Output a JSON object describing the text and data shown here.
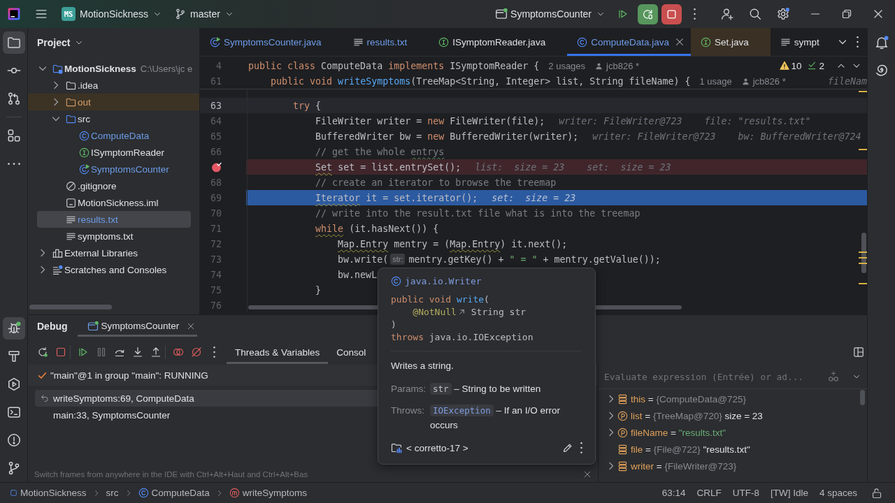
{
  "title_bar": {
    "project_badge": "MS",
    "project": "MotionSickness",
    "branch": "master",
    "run_configuration": "SymptomsCounter"
  },
  "left_toolbar": {
    "top": [
      {
        "kind": "project",
        "selected": true
      },
      {
        "kind": "commit",
        "selected": false
      },
      {
        "kind": "pull_requests",
        "selected": false
      },
      {
        "kind": "structure",
        "selected": false
      },
      {
        "kind": "more",
        "selected": false
      }
    ],
    "bottom": [
      {
        "kind": "debug",
        "selected": true
      },
      {
        "kind": "build",
        "selected": false
      },
      {
        "kind": "services",
        "selected": false
      },
      {
        "kind": "terminal",
        "selected": false
      },
      {
        "kind": "problems",
        "selected": false
      },
      {
        "kind": "git",
        "selected": false
      }
    ]
  },
  "project_panel": {
    "title": "Project",
    "tree": [
      {
        "kind": "module",
        "label": "MotionSickness",
        "path": "C:\\Users\\jc e",
        "expanded": true,
        "selected": false,
        "modified": false,
        "children": [
          {
            "kind": "folder",
            "label": ".idea",
            "expanded": false,
            "selected": false,
            "modified": false
          },
          {
            "kind": "excluded_folder",
            "label": "out",
            "expanded": false,
            "selected": false,
            "modified": false
          },
          {
            "kind": "source_folder",
            "label": "src",
            "expanded": true,
            "selected": false,
            "modified": false,
            "children": [
              {
                "kind": "class",
                "label": "ComputeData",
                "selected": false,
                "modified": true
              },
              {
                "kind": "interface",
                "label": "ISymptomReader",
                "selected": false,
                "modified": false
              },
              {
                "kind": "runnable_class",
                "label": "SymptomsCounter",
                "selected": false,
                "modified": true
              }
            ]
          },
          {
            "kind": "ignore_file",
            "label": ".gitignore",
            "selected": false,
            "modified": false
          },
          {
            "kind": "module_file",
            "label": "MotionSickness.iml",
            "selected": false,
            "modified": false
          },
          {
            "kind": "text_file",
            "label": "results.txt",
            "selected": true,
            "modified": true
          },
          {
            "kind": "text_file",
            "label": "symptoms.txt",
            "selected": false,
            "modified": false
          }
        ]
      },
      {
        "kind": "library",
        "label": "External Libraries",
        "expanded": false,
        "selected": false,
        "modified": false
      },
      {
        "kind": "scratches",
        "label": "Scratches and Consoles",
        "expanded": false,
        "selected": false,
        "modified": false
      }
    ]
  },
  "editor": {
    "tabs": [
      {
        "kind": "runnable_class",
        "label": "SymptomsCounter.java",
        "selected": false,
        "modified": true,
        "non_project": false
      },
      {
        "kind": "text_file",
        "label": "results.txt",
        "selected": false,
        "modified": true,
        "non_project": false
      },
      {
        "kind": "interface",
        "label": "ISymptomReader.java",
        "selected": false,
        "modified": false,
        "non_project": false
      },
      {
        "kind": "class",
        "label": "ComputeData.java",
        "selected": true,
        "modified": true,
        "non_project": false
      },
      {
        "kind": "interface",
        "label": "Set.java",
        "selected": false,
        "modified": false,
        "non_project": true
      },
      {
        "kind": "text_file",
        "label": "sympt",
        "selected": false,
        "modified": false,
        "non_project": false
      }
    ],
    "problems": {
      "warnings": "10",
      "typos": "2"
    },
    "sticky_lines": [
      {
        "number": "4",
        "tokens": [
          {
            "text": "public class ",
            "kind": "keyword"
          },
          {
            "text": "ComputeData ",
            "kind": "plain"
          },
          {
            "text": "implements ",
            "kind": "keyword"
          },
          {
            "text": "ISymptomReader {",
            "kind": "plain"
          }
        ],
        "usages": "2 usages",
        "author": "jcb826 *"
      },
      {
        "number": "61",
        "tokens": [
          {
            "text": "    public void ",
            "kind": "keyword"
          },
          {
            "text": "writeSymptoms",
            "kind": "method"
          },
          {
            "text": "(TreeMap<String, Integer> list, String fileName) {",
            "kind": "plain"
          }
        ],
        "usages": "1 usage",
        "author": "jcb826 *",
        "hint": "fileNam"
      }
    ],
    "lines": [
      {
        "number": "63",
        "caret": true,
        "breakpoint": false,
        "execution_point": false,
        "tokens": [
          {
            "text": "        try",
            "kind": "keyword"
          },
          {
            "text": " {",
            "kind": "plain"
          }
        ]
      },
      {
        "number": "64",
        "caret": false,
        "breakpoint": false,
        "execution_point": false,
        "tokens": [
          {
            "text": "            FileWriter writer = ",
            "kind": "plain"
          },
          {
            "text": "new",
            "kind": "keyword"
          },
          {
            "text": " FileWriter(file);",
            "kind": "plain"
          },
          {
            "text": "writer: FileWriter@723    file: \"results.txt\"",
            "kind": "hint"
          }
        ]
      },
      {
        "number": "65",
        "caret": false,
        "breakpoint": false,
        "execution_point": false,
        "tokens": [
          {
            "text": "            BufferedWriter bw = ",
            "kind": "plain"
          },
          {
            "text": "new",
            "kind": "keyword"
          },
          {
            "text": " BufferedWriter(writer);",
            "kind": "plain"
          },
          {
            "text": "writer: FileWriter@723    bw: BufferedWriter@724",
            "kind": "hint"
          }
        ]
      },
      {
        "number": "66",
        "caret": false,
        "breakpoint": false,
        "execution_point": false,
        "tokens": [
          {
            "text": "            // get the whole ",
            "kind": "comment"
          },
          {
            "text": "entrys",
            "kind": "comment_warned"
          }
        ]
      },
      {
        "caret": false,
        "breakpoint": true,
        "execution_point": false,
        "tokens": [
          {
            "text": "            Set",
            "kind": "plain_warned"
          },
          {
            "text": " set = list.entrySet();",
            "kind": "plain"
          },
          {
            "text": "list:  size = 23    set:  size = 23",
            "kind": "hint"
          }
        ]
      },
      {
        "number": "68",
        "caret": false,
        "breakpoint": false,
        "execution_point": false,
        "tokens": [
          {
            "text": "            // create an iterator to browse the treemap",
            "kind": "comment"
          }
        ]
      },
      {
        "number": "69",
        "caret": false,
        "breakpoint": false,
        "execution_point": true,
        "tokens": [
          {
            "text": "            Iterator",
            "kind": "plain_warned"
          },
          {
            "text": " it = set.iterator();",
            "kind": "plain"
          },
          {
            "text": "set:  size = 23",
            "kind": "hint"
          }
        ]
      },
      {
        "number": "70",
        "caret": false,
        "breakpoint": false,
        "execution_point": false,
        "tokens": [
          {
            "text": "            // write into the result.txt file what is into the treemap",
            "kind": "comment"
          }
        ]
      },
      {
        "number": "71",
        "caret": false,
        "breakpoint": false,
        "execution_point": false,
        "tokens": [
          {
            "text": "            while",
            "kind": "keyword_warned"
          },
          {
            "text": " (it.hasNext()) {",
            "kind": "plain"
          }
        ]
      },
      {
        "number": "72",
        "caret": false,
        "breakpoint": false,
        "execution_point": false,
        "tokens": [
          {
            "text": "                Map.Entry",
            "kind": "plain_warned"
          },
          {
            "text": " mentry = (",
            "kind": "plain"
          },
          {
            "text": "Map.Entry",
            "kind": "plain_warned"
          },
          {
            "text": ") it.next();",
            "kind": "plain"
          }
        ]
      },
      {
        "number": "73",
        "caret": false,
        "breakpoint": false,
        "execution_point": false,
        "tokens": [
          {
            "text": "                bw.write(",
            "kind": "plain"
          },
          {
            "text": "str:",
            "kind": "inlay"
          },
          {
            "text": "mentry.getKey() + ",
            "kind": "plain"
          },
          {
            "text": "\" = \"",
            "kind": "string"
          },
          {
            "text": " + mentry.getValue());",
            "kind": "plain"
          }
        ]
      },
      {
        "number": "74",
        "caret": false,
        "breakpoint": false,
        "execution_point": false,
        "tokens": [
          {
            "text": "                bw.newL",
            "kind": "plain"
          }
        ]
      },
      {
        "number": "75",
        "caret": false,
        "breakpoint": false,
        "execution_point": false,
        "tokens": [
          {
            "text": "            }",
            "kind": "plain"
          }
        ]
      },
      {
        "number": "76",
        "caret": false,
        "breakpoint": false,
        "execution_point": false
      }
    ]
  },
  "debug": {
    "title": "Debug",
    "session": "SymptomsCounter",
    "toolbar": [
      {
        "kind": "rerun",
        "disabled": false
      },
      {
        "kind": "stop",
        "disabled": false
      },
      {
        "kind": "resume",
        "disabled": false
      },
      {
        "kind": "pause",
        "disabled": true
      },
      {
        "kind": "step_over",
        "disabled": false
      },
      {
        "kind": "step_into",
        "disabled": false
      },
      {
        "kind": "step_out",
        "disabled": false
      },
      {
        "kind": "view_breakpoints",
        "disabled": false
      },
      {
        "kind": "mute_breakpoints",
        "disabled": false
      },
      {
        "kind": "more",
        "disabled": false
      }
    ],
    "tabs": [
      {
        "label": "Threads & Variables",
        "selected": true
      },
      {
        "label": "Consol",
        "selected": false
      }
    ],
    "thread": "\"main\"@1 in group \"main\": RUNNING",
    "frames": [
      {
        "label": "writeSymptoms:69, ComputeData",
        "selected": true
      },
      {
        "label": "main:33, SymptomsCounter",
        "selected": false
      }
    ],
    "hint": "Switch frames from anywhere in the IDE with Ctrl+Alt+Haut and Ctrl+Alt+Bas",
    "evaluate": {
      "placeholder": "Evaluate expression (Entrée) or ad..."
    },
    "variables": [
      {
        "kind": "field",
        "name": "this",
        "equals": "=",
        "ref": "{ComputeData@725}",
        "expanded": false
      },
      {
        "kind": "param",
        "name": "list",
        "equals": "=",
        "ref": "{TreeMap@720}",
        "value": "size = 23",
        "expanded": false
      },
      {
        "kind": "param",
        "name": "fileName",
        "equals": "=",
        "string": "\"results.txt\"",
        "expanded": false
      },
      {
        "kind": "field",
        "name": "file",
        "equals": "=",
        "ref": "{File@722}",
        "value": "\"results.txt\""
      },
      {
        "kind": "field",
        "name": "writer",
        "equals": "=",
        "ref": "{FileWriter@723}",
        "expanded": false
      }
    ]
  },
  "doc_popup": {
    "class_name": "java.io.Writer",
    "signature": [
      [
        {
          "text": "public void ",
          "kind": "keyword"
        },
        {
          "text": "write",
          "kind": "method"
        },
        {
          "text": "(",
          "kind": "plain"
        }
      ],
      [
        {
          "text": "    @NotNull",
          "kind": "annotation_link"
        },
        {
          "text": " String str",
          "kind": "plain"
        }
      ],
      [
        {
          "text": ")",
          "kind": "plain"
        }
      ],
      [
        {
          "text": "throws ",
          "kind": "keyword"
        },
        {
          "text": "java.io.IOException",
          "kind": "plain"
        }
      ]
    ],
    "description": "Writes a string.",
    "params_label": "Params:",
    "param": "str",
    "param_text": "– String to be written",
    "throws_label": "Throws:",
    "exception": "IOException",
    "throws_text": "– If an I/O error occurs",
    "library": "< corretto-17 >"
  },
  "status_bar": {
    "breadcrumbs": [
      {
        "kind": "module",
        "label": "MotionSickness"
      },
      {
        "kind": "folder",
        "label": "src"
      },
      {
        "kind": "class",
        "label": "ComputeData"
      },
      {
        "kind": "method",
        "label": "writeSymptoms"
      }
    ],
    "items": [
      "63:14",
      "CRLF",
      "UTF-8",
      "[TW] Idle",
      "4 spaces"
    ]
  }
}
